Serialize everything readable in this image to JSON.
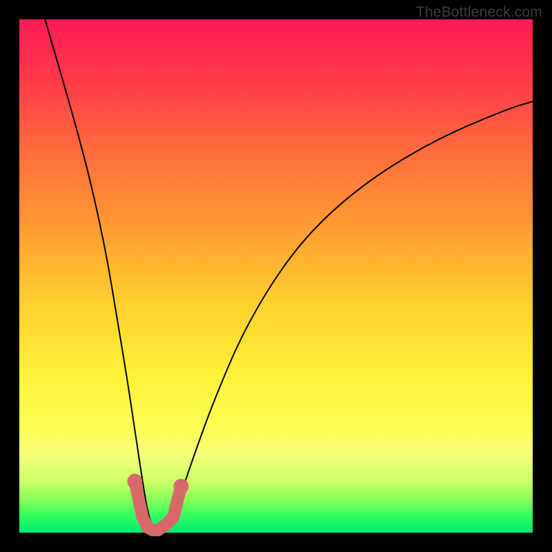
{
  "attribution": "TheBottleneck.com",
  "colors": {
    "background": "#000000",
    "gradient_top": "#ff1a55",
    "gradient_bottom": "#00e877",
    "curve": "#000000",
    "marker": "#d66a6a"
  },
  "chart_data": {
    "type": "line",
    "title": "",
    "xlabel": "",
    "ylabel": "",
    "xlim": [
      0,
      100
    ],
    "ylim": [
      0,
      100
    ],
    "series": [
      {
        "name": "bottleneck-curve",
        "x": [
          5,
          10,
          14,
          17,
          19,
          21,
          22.5,
          24,
          25,
          26,
          27,
          28.5,
          30,
          32,
          34,
          38,
          44,
          52,
          60,
          70,
          82,
          95,
          100
        ],
        "values": [
          100,
          83,
          68,
          54,
          42,
          30,
          20,
          10,
          4,
          1,
          0.5,
          1.5,
          4,
          9,
          15,
          26,
          40,
          53,
          62,
          70,
          77,
          82.5,
          84
        ]
      },
      {
        "name": "highlighted-minimum",
        "x": [
          22.5,
          24,
          25,
          26,
          27,
          28.5,
          30,
          31.5
        ],
        "values": [
          10,
          3,
          1,
          0.5,
          0.5,
          1.5,
          3,
          9
        ]
      }
    ],
    "annotations": [
      {
        "text": "TheBottleneck.com",
        "position": "top-right"
      }
    ]
  }
}
